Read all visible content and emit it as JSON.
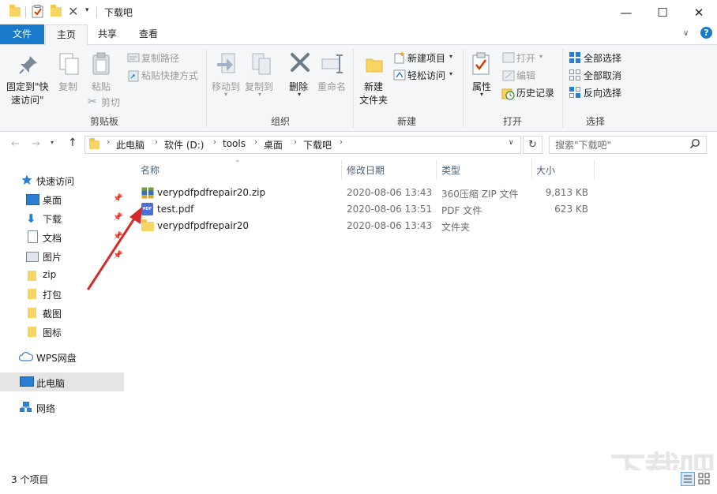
{
  "window": {
    "title": "下载吧",
    "minimize_glyph": "—",
    "maximize_glyph": "☐",
    "close_glyph": "✕"
  },
  "ribbon_tabs": [
    "文件",
    "主页",
    "共享",
    "查看"
  ],
  "ribbon": {
    "clipboard": {
      "pin_label_1": "固定到\"快",
      "pin_label_2": "速访问\"",
      "copy": "复制",
      "paste": "粘贴",
      "copy_path": "复制路径",
      "paste_shortcut": "粘贴快捷方式",
      "cut": "剪切",
      "group": "剪贴板"
    },
    "organize": {
      "move_to": "移动到",
      "copy_to": "复制到",
      "delete": "删除",
      "rename": "重命名",
      "group": "组织"
    },
    "new": {
      "new_folder_1": "新建",
      "new_folder_2": "文件夹",
      "new_item": "新建项目",
      "easy_access": "轻松访问",
      "group": "新建"
    },
    "open": {
      "properties": "属性",
      "open": "打开",
      "edit": "编辑",
      "history": "历史记录",
      "group": "打开"
    },
    "select": {
      "select_all": "全部选择",
      "select_none": "全部取消",
      "invert": "反向选择",
      "group": "选择"
    }
  },
  "address": {
    "crumbs": [
      "此电脑",
      "软件 (D:)",
      "tools",
      "桌面",
      "下载吧"
    ],
    "search_placeholder": "搜索\"下载吧\""
  },
  "nav": {
    "quick_access": "快速访问",
    "items": [
      "桌面",
      "下载",
      "文档",
      "图片",
      "zip",
      "打包",
      "截图",
      "图标"
    ],
    "wps": "WPS网盘",
    "this_pc": "此电脑",
    "network": "网络"
  },
  "columns": [
    "名称",
    "修改日期",
    "类型",
    "大小"
  ],
  "files": [
    {
      "name": "verypdfpdfrepair20.zip",
      "date": "2020-08-06 13:43",
      "type": "360压缩 ZIP 文件",
      "size": "9,813 KB",
      "icon": "zip-archive-icon"
    },
    {
      "name": "test.pdf",
      "date": "2020-08-06 13:51",
      "type": "PDF 文件",
      "size": "623 KB",
      "icon": "pdf-file-icon"
    },
    {
      "name": "verypdfpdfrepair20",
      "date": "2020-08-06 13:43",
      "type": "文件夹",
      "size": "",
      "icon": "folder-icon"
    }
  ],
  "status": {
    "count": "3 个项目"
  },
  "watermark": "下载吧",
  "colors": {
    "accent": "#1979ca",
    "selected_nav": "#e5e5e5",
    "folder": "#f8d563",
    "arrow": "#d42a2a"
  }
}
